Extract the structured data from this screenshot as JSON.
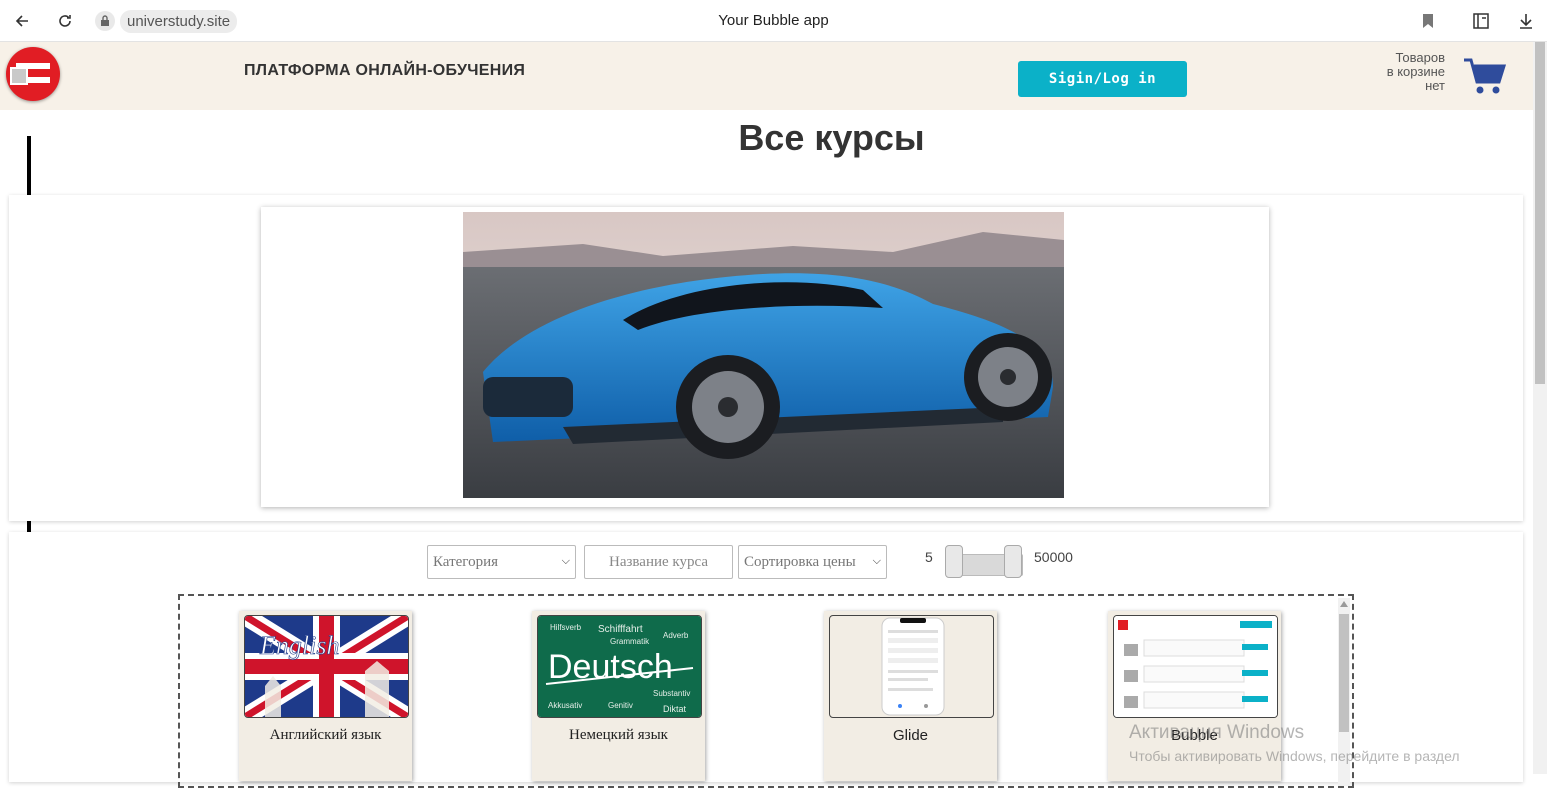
{
  "browser": {
    "url": "universtudy.site",
    "tab_title": "Your Bubble app"
  },
  "header": {
    "brand": "ПЛАТФОРМА ОНЛАЙН-ОБУЧЕНИЯ",
    "signin_label": "Sigin/Log in",
    "cart_line1": "Товаров",
    "cart_line2": "в корзине",
    "cart_line3": "нет",
    "cart_color": "#2f4c9c",
    "accent": "#0bb1c8"
  },
  "page": {
    "heading": "Все курсы"
  },
  "filters": {
    "category_placeholder": "Категория",
    "course_name_placeholder": "Название курса",
    "price_sort_placeholder": "Сортировка цены",
    "price_min": "5",
    "price_max": "50000"
  },
  "courses": [
    {
      "title": "Английский язык"
    },
    {
      "title": "Немецкий язык"
    },
    {
      "title": "Glide"
    },
    {
      "title": "Bubble"
    }
  ],
  "watermark": {
    "line1": "Активация Windows",
    "line2": "Чтобы активировать Windows, перейдите в раздел"
  }
}
